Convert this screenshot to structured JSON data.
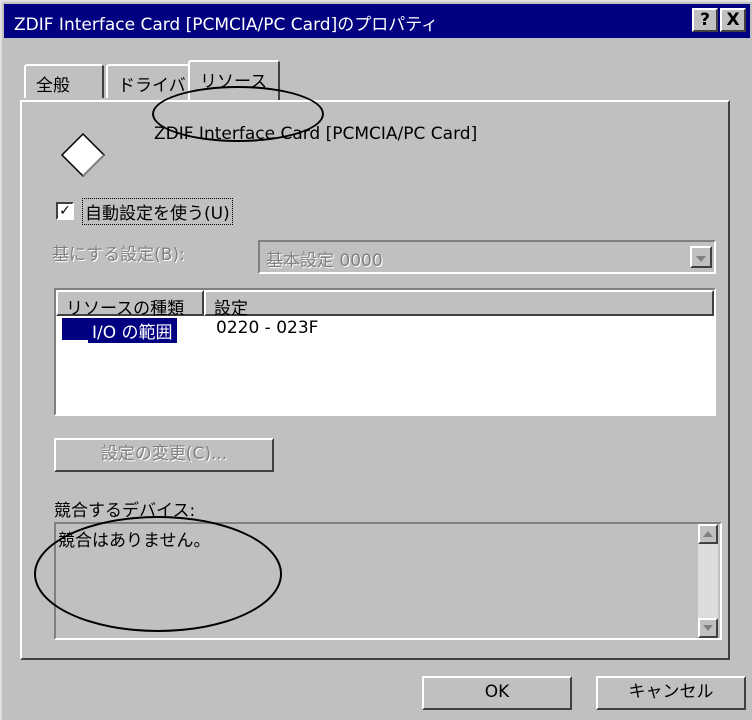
{
  "window": {
    "title": "ZDIF Interface Card [PCMCIA/PC Card]のプロパティ",
    "help_button": "?",
    "close_button": "X"
  },
  "tabs": [
    {
      "label": "全般"
    },
    {
      "label": "ドライバ"
    },
    {
      "label": "リソース",
      "active": true
    }
  ],
  "device": {
    "icon": "diamond-device-icon",
    "name": "ZDIF Interface Card [PCMCIA/PC Card]"
  },
  "auto_settings": {
    "checked": true,
    "label": "自動設定を使う(U)"
  },
  "base_setting": {
    "label": "基にする設定(B):",
    "value": "基本設定 0000",
    "enabled": false
  },
  "resource_table": {
    "columns": [
      "リソースの種類",
      "設定"
    ],
    "rows": [
      {
        "type": "I/O の範囲",
        "setting": "0220 - 023F",
        "selected": true
      }
    ]
  },
  "change_settings_button": "設定の変更(C)...",
  "conflict": {
    "label": "競合するデバイス:",
    "message": "競合はありません。"
  },
  "buttons": {
    "ok": "OK",
    "cancel": "キャンセル"
  },
  "colors": {
    "title_bar": "#000080",
    "face": "#c0c0c0",
    "selection": "#000080"
  }
}
